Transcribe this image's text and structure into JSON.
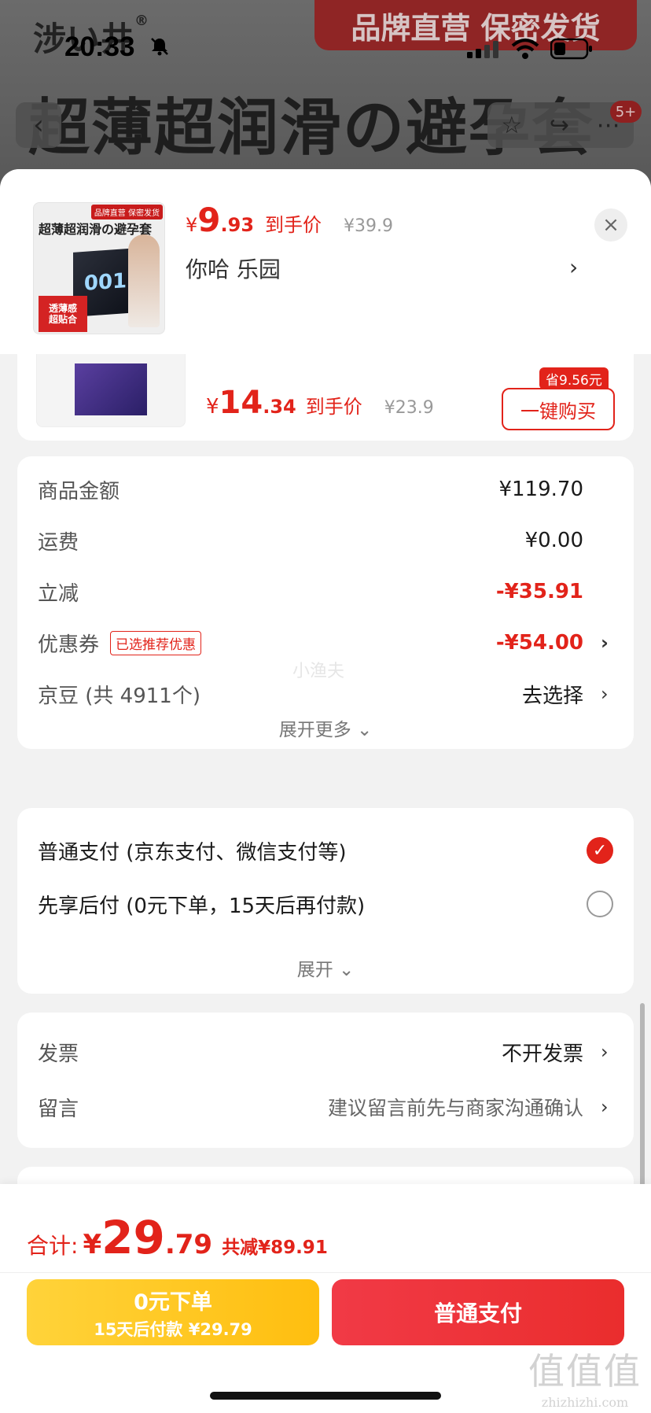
{
  "status": {
    "time": "20:33"
  },
  "background_page": {
    "brand": "涉い井",
    "brand_mark": "®",
    "banner": "品牌直营 保密发货",
    "headline": "超薄超润滑の避孕套",
    "badge": "5+"
  },
  "header": {
    "thumb_tag": "品牌直营 保密发货",
    "thumb_title": "超薄超润滑の避孕套",
    "thumb_box_text": "001",
    "thumb_label_1": "透薄感",
    "thumb_label_2": "超贴合",
    "price_yen": "¥",
    "price_int": "9",
    "price_dec": ".93",
    "price_suffix": "到手价",
    "original_price": "¥39.9",
    "spec": "你哈  乐园",
    "close_icon": "×"
  },
  "recommended": {
    "price_yen": "¥",
    "price_int": "14",
    "price_dec": ".34",
    "price_suffix": "到手价",
    "original_price": "¥23.9",
    "save_tag": "省9.56元",
    "buy_label": "一键购买"
  },
  "summary": {
    "goods_label": "商品金额",
    "goods_value": "¥119.70",
    "shipping_label": "运费",
    "shipping_value": "¥0.00",
    "discount_label": "立减",
    "discount_value": "-¥35.91",
    "coupon_label": "优惠券",
    "coupon_tag": "已选推荐优惠",
    "coupon_value": "-¥54.00",
    "beans_label": "京豆 (共 4911个)",
    "beans_value": "去选择",
    "expand_label": "展开更多",
    "watermark": "小渔夫"
  },
  "payment": {
    "options": [
      {
        "label": "普通支付 (京东支付、微信支付等)",
        "selected": true
      },
      {
        "label": "先享后付 (0元下单，15天后再付款)",
        "selected": false
      }
    ],
    "expand_label": "展开"
  },
  "extras": {
    "invoice_label": "发票",
    "invoice_value": "不开发票",
    "remark_label": "留言",
    "remark_value": "建议留言前先与商家沟通确认"
  },
  "bottom": {
    "total_label": "合计:",
    "total_yen": "¥",
    "total_int": "29",
    "total_dec": ".79",
    "total_saving": "共减¥89.91",
    "later_line1": "0元下单",
    "later_line2": "15天后付款 ¥29.79",
    "pay_label": "普通支付"
  },
  "watermark_site": {
    "big": "值值值",
    "small": "zhizhizhi.com"
  },
  "colors": {
    "accent_red": "#e2231a",
    "later_yellow": "#ffc21a"
  },
  "icons": {
    "chevron": "chevron-right-icon",
    "check": "check-icon",
    "close": "close-icon"
  }
}
